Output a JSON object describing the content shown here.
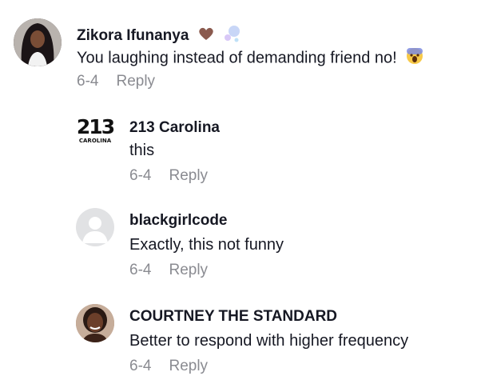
{
  "comments": [
    {
      "author": "Zikora Ifunanya",
      "text": "You laughing instead of demanding friend no!",
      "date": "6-4",
      "reply_label": "Reply",
      "avatar_icon": "profile-photo-woman-long-hair",
      "name_emojis": [
        "brown-heart-icon",
        "bubbles-icon"
      ],
      "text_emoji": "screaming-face-icon"
    },
    {
      "author": "213 Carolina",
      "text": "this",
      "date": "6-4",
      "reply_label": "Reply",
      "avatar_logo_text": "213",
      "avatar_logo_subtext": "CAROLINA"
    },
    {
      "author": "blackgirlcode",
      "text": "Exactly, this not funny",
      "date": "6-4",
      "reply_label": "Reply",
      "avatar_icon": "default-user-icon"
    },
    {
      "author": "COURTNEY THE STANDARD",
      "text": "Better to respond with higher frequency",
      "date": "6-4",
      "reply_label": "Reply",
      "avatar_icon": "profile-photo-woman"
    }
  ]
}
